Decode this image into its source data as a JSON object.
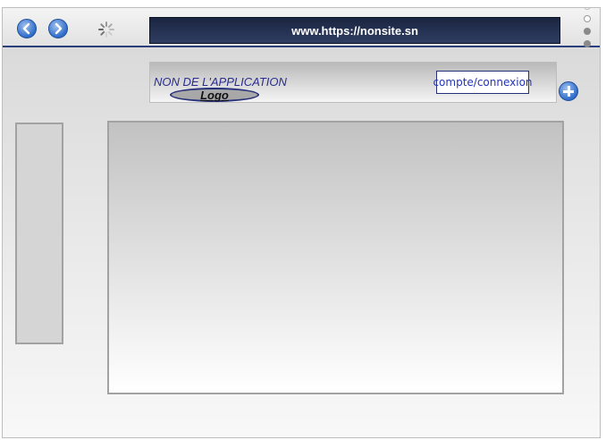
{
  "browser": {
    "url": "www.https://nonsite.sn",
    "icons": [
      "back-arrow-icon",
      "forward-arrow-icon",
      "loading-spinner-icon",
      "plus-icon"
    ]
  },
  "app_header": {
    "app_name": "NON DE L'APPLICATION",
    "logo_label": "Logo",
    "account_label": "compte/connexion"
  },
  "colors": {
    "accent_blue": "#2f6cc8",
    "url_bar_bg": "#1a2540",
    "app_title_color": "#2a2d8a",
    "account_text": "#2333b8"
  }
}
